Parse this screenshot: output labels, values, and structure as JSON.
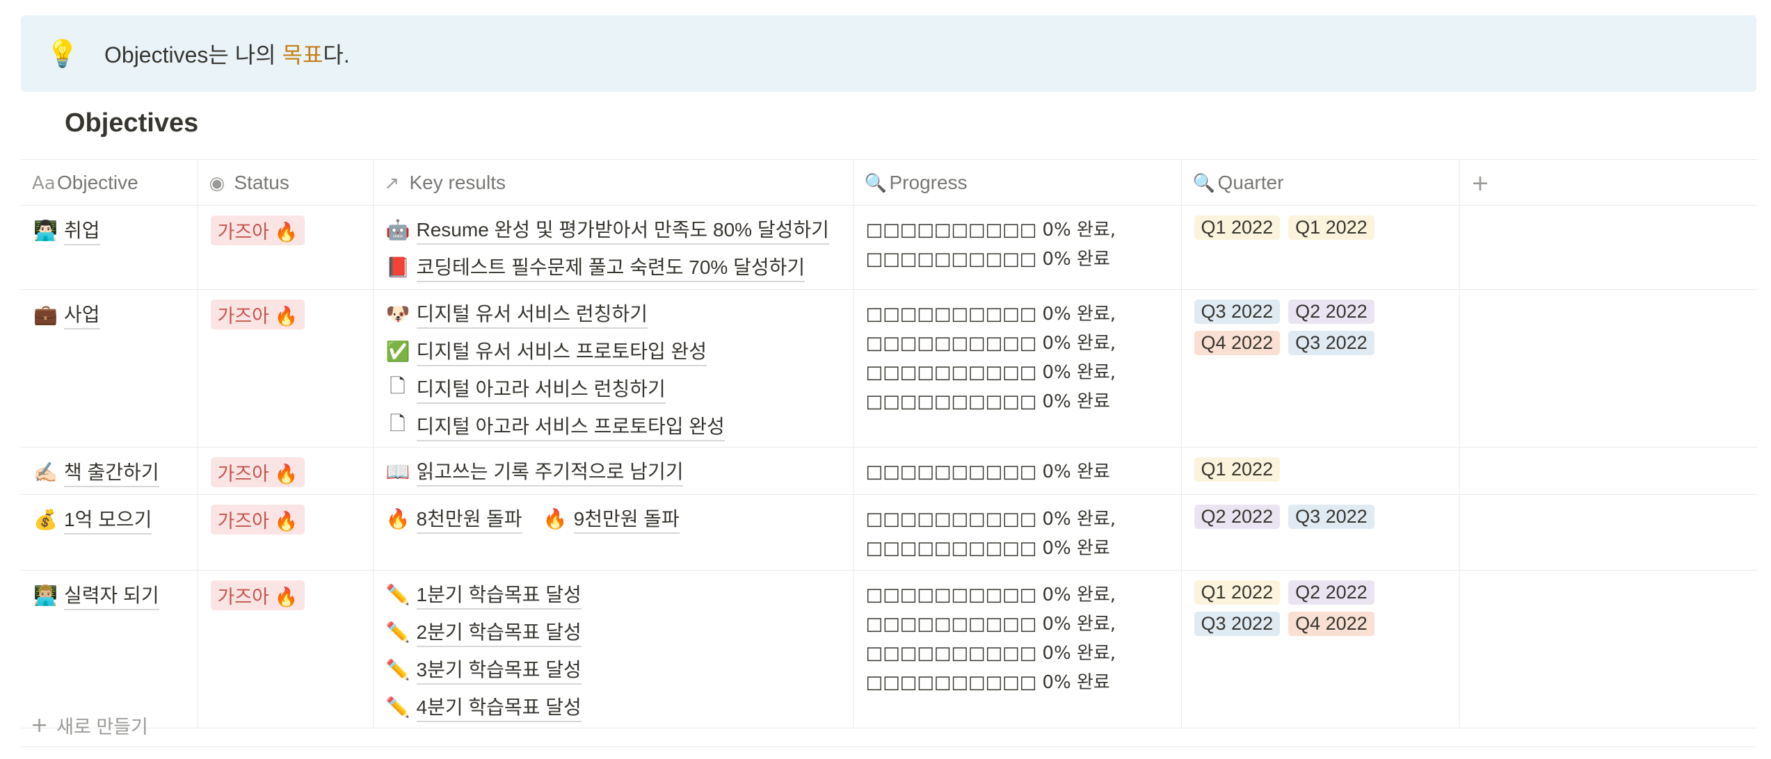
{
  "callout": {
    "icon": "lightbulb-icon",
    "glyph": "💡",
    "text_before": "Objectives는 나의 ",
    "text_highlight": "목표",
    "text_after": "다."
  },
  "database": {
    "title": "Objectives",
    "columns": [
      {
        "label": "Objective",
        "icon": "text-aa-icon",
        "glyph": "Aa"
      },
      {
        "label": "Status",
        "icon": "status-icon",
        "glyph": "◉"
      },
      {
        "label": "Key results",
        "icon": "relation-arrow-icon",
        "glyph": "↗"
      },
      {
        "label": "Progress",
        "icon": "search-icon",
        "glyph": "🔍"
      },
      {
        "label": "Quarter",
        "icon": "search-icon",
        "glyph": "🔍"
      },
      {
        "label": "",
        "icon": "add-column-icon",
        "glyph": "+"
      }
    ],
    "rows": [
      {
        "emoji": "👨🏻‍💻",
        "objective": "취업",
        "status": "가즈아 🔥",
        "key_results": [
          {
            "emoji": "🤖",
            "text": "Resume 완성 및 평가받아서 만족도 80% 달성하기"
          },
          {
            "emoji": "📕",
            "text": "코딩테스트 필수문제 풀고 숙련도 70% 달성하기"
          }
        ],
        "progress": [
          "□□□□□□□□□□ 0% 완료,",
          "□□□□□□□□□□ 0% 완료"
        ],
        "quarters": [
          {
            "label": "Q1 2022",
            "color": "#fbf3db"
          },
          {
            "label": "Q1 2022",
            "color": "#fbf3db"
          }
        ]
      },
      {
        "emoji": "💼",
        "objective": "사업",
        "status": "가즈아 🔥",
        "key_results": [
          {
            "emoji": "🐶",
            "text": "디지털 유서 서비스 런칭하기"
          },
          {
            "emoji": "✅",
            "text": "디지털 유서 서비스 프로토타입 완성"
          },
          {
            "emoji": "🗋",
            "text": "디지털 아고라 서비스 런칭하기"
          },
          {
            "emoji": "🗋",
            "text": "디지털 아고라 서비스 프로토타입 완성"
          }
        ],
        "progress": [
          "□□□□□□□□□□ 0% 완료,",
          "□□□□□□□□□□ 0% 완료,",
          "□□□□□□□□□□ 0% 완료,",
          "□□□□□□□□□□ 0% 완료"
        ],
        "quarters": [
          {
            "label": "Q3 2022",
            "color": "#dfeaf3"
          },
          {
            "label": "Q2 2022",
            "color": "#eae4f2"
          },
          {
            "label": "Q4 2022",
            "color": "#f9e0d3"
          },
          {
            "label": "Q3 2022",
            "color": "#dfeaf3"
          }
        ]
      },
      {
        "emoji": "✍🏻",
        "objective": "책 출간하기",
        "status": "가즈아 🔥",
        "key_results": [
          {
            "emoji": "📖",
            "text": "읽고쓰는 기록 주기적으로 남기기"
          }
        ],
        "progress": [
          "□□□□□□□□□□ 0% 완료"
        ],
        "quarters": [
          {
            "label": "Q1 2022",
            "color": "#fbf3db"
          }
        ]
      },
      {
        "emoji": "💰",
        "objective": "1억 모으기",
        "status": "가즈아 🔥",
        "key_results": [
          {
            "emoji": "🔥",
            "text": "8천만원 돌파"
          },
          {
            "emoji": "🔥",
            "text": "9천만원 돌파"
          }
        ],
        "progress": [
          "□□□□□□□□□□ 0% 완료,",
          "□□□□□□□□□□ 0% 완료"
        ],
        "quarters": [
          {
            "label": "Q2 2022",
            "color": "#eae4f2"
          },
          {
            "label": "Q3 2022",
            "color": "#dfeaf3"
          }
        ]
      },
      {
        "emoji": "👨🏼‍💻",
        "objective": "실력자 되기",
        "status": "가즈아 🔥",
        "key_results": [
          {
            "emoji": "✏️",
            "text": "1분기 학습목표 달성"
          },
          {
            "emoji": "✏️",
            "text": "2분기 학습목표 달성"
          },
          {
            "emoji": "✏️",
            "text": "3분기 학습목표 달성"
          },
          {
            "emoji": "✏️",
            "text": "4분기 학습목표 달성"
          }
        ],
        "progress": [
          "□□□□□□□□□□ 0% 완료,",
          "□□□□□□□□□□ 0% 완료,",
          "□□□□□□□□□□ 0% 완료,",
          "□□□□□□□□□□ 0% 완료"
        ],
        "quarters": [
          {
            "label": "Q1 2022",
            "color": "#fbf3db"
          },
          {
            "label": "Q2 2022",
            "color": "#eae4f2"
          },
          {
            "label": "Q3 2022",
            "color": "#dfeaf3"
          },
          {
            "label": "Q4 2022",
            "color": "#f9e0d3"
          }
        ]
      }
    ],
    "new_row_label": "새로 만들기"
  }
}
